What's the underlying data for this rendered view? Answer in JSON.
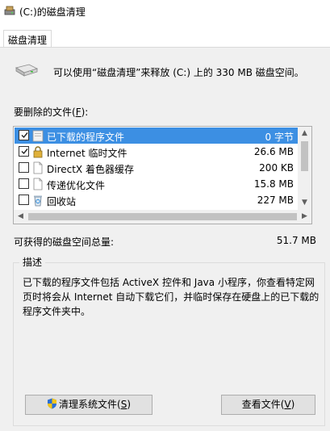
{
  "window": {
    "title": "(C:)的磁盘清理"
  },
  "tabs": [
    {
      "label": "磁盘清理",
      "active": true
    }
  ],
  "summary": "可以使用“磁盘清理”来释放 (C:) 上的 330 MB 磁盘空间。",
  "files_section": {
    "label_prefix": "要删除的文件(",
    "label_accel": "F",
    "label_suffix": "):"
  },
  "file_list": [
    {
      "checked": true,
      "name": "已下载的程序文件",
      "size": "0 字节",
      "selected": true,
      "icon": "folder-icon"
    },
    {
      "checked": true,
      "name": "Internet 临时文件",
      "size": "26.6 MB",
      "selected": false,
      "icon": "lock-icon"
    },
    {
      "checked": false,
      "name": "DirectX 着色器缓存",
      "size": "200 KB",
      "selected": false,
      "icon": "document-icon"
    },
    {
      "checked": false,
      "name": "传递优化文件",
      "size": "15.8 MB",
      "selected": false,
      "icon": "document-icon"
    },
    {
      "checked": false,
      "name": "回收站",
      "size": "227 MB",
      "selected": false,
      "icon": "recycle-bin-icon"
    }
  ],
  "total": {
    "label": "可获得的磁盘空间总量:",
    "value": "51.7 MB"
  },
  "description": {
    "title": "描述",
    "text": "已下载的程序文件包括 ActiveX 控件和 Java 小程序，你查看特定网页时将会从 Internet 自动下载它们，并临时保存在硬盘上的已下载的程序文件夹中。"
  },
  "buttons": {
    "clean_system_prefix": "清理系统文件(",
    "clean_system_accel": "S",
    "clean_system_suffix": ")",
    "view_files_prefix": "查看文件(",
    "view_files_accel": "V",
    "view_files_suffix": ")"
  },
  "colors": {
    "selection": "#3c8fe3",
    "panel_bg": "#f0f0f0",
    "button_bg": "#e1e1e1"
  }
}
